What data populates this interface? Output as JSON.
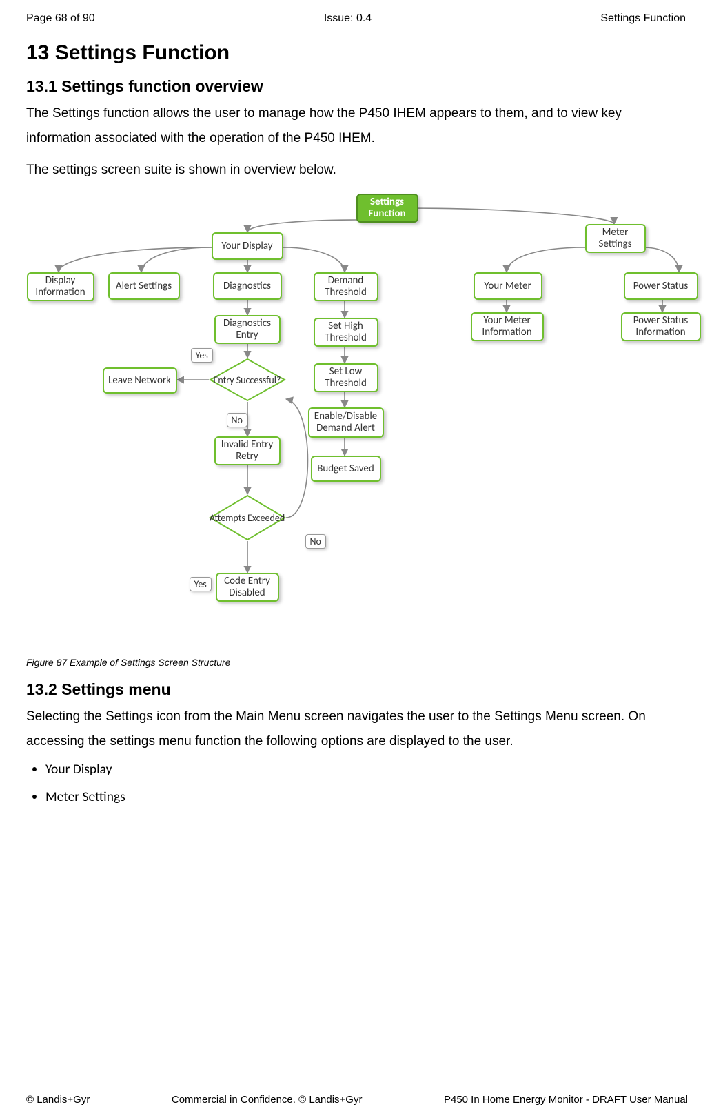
{
  "header": {
    "left": "Page 68 of 90",
    "center": "Issue: 0.4",
    "right": "Settings Function"
  },
  "h1": "13    Settings Function",
  "h2a": "13.1    Settings function overview",
  "p1": "The Settings function allows the user to manage how the P450 IHEM appears to them, and to view key information associated with the operation of the P450 IHEM.",
  "p2": "The settings screen suite is shown in overview below.",
  "caption": "Figure 87 Example of Settings Screen Structure",
  "h2b": "13.2    Settings menu",
  "p3": "Selecting the Settings icon from the Main Menu screen navigates the user to the Settings Menu screen. On accessing the settings menu function the following options are displayed to the user.",
  "bullets": [
    "Your Display",
    "Meter Settings"
  ],
  "footer": {
    "left": "© Landis+Gyr",
    "center": "Commercial in Confidence. © Landis+Gyr",
    "right": "P450 In Home Energy Monitor - DRAFT User Manual"
  },
  "nodes": {
    "root": "Settings Function",
    "your_display": "Your Display",
    "meter_settings": "Meter Settings",
    "display_info": "Display Information",
    "alert_settings": "Alert Settings",
    "diagnostics": "Diagnostics",
    "demand_threshold": "Demand Threshold",
    "your_meter": "Your Meter",
    "power_status": "Power Status",
    "your_meter_info": "Your Meter Information",
    "power_status_info": "Power Status Information",
    "diag_entry": "Diagnostics Entry",
    "entry_successful": "Entry Successful?",
    "leave_network": "Leave Network",
    "invalid_retry": "Invalid Entry Retry",
    "attempts_exceeded": "Attempts Exceeded",
    "code_entry_disabled": "Code Entry Disabled",
    "set_high": "Set High Threshold",
    "set_low": "Set Low Threshold",
    "enable_disable": "Enable/Disable Demand Alert",
    "budget_saved": "Budget Saved",
    "yes": "Yes",
    "no": "No"
  }
}
